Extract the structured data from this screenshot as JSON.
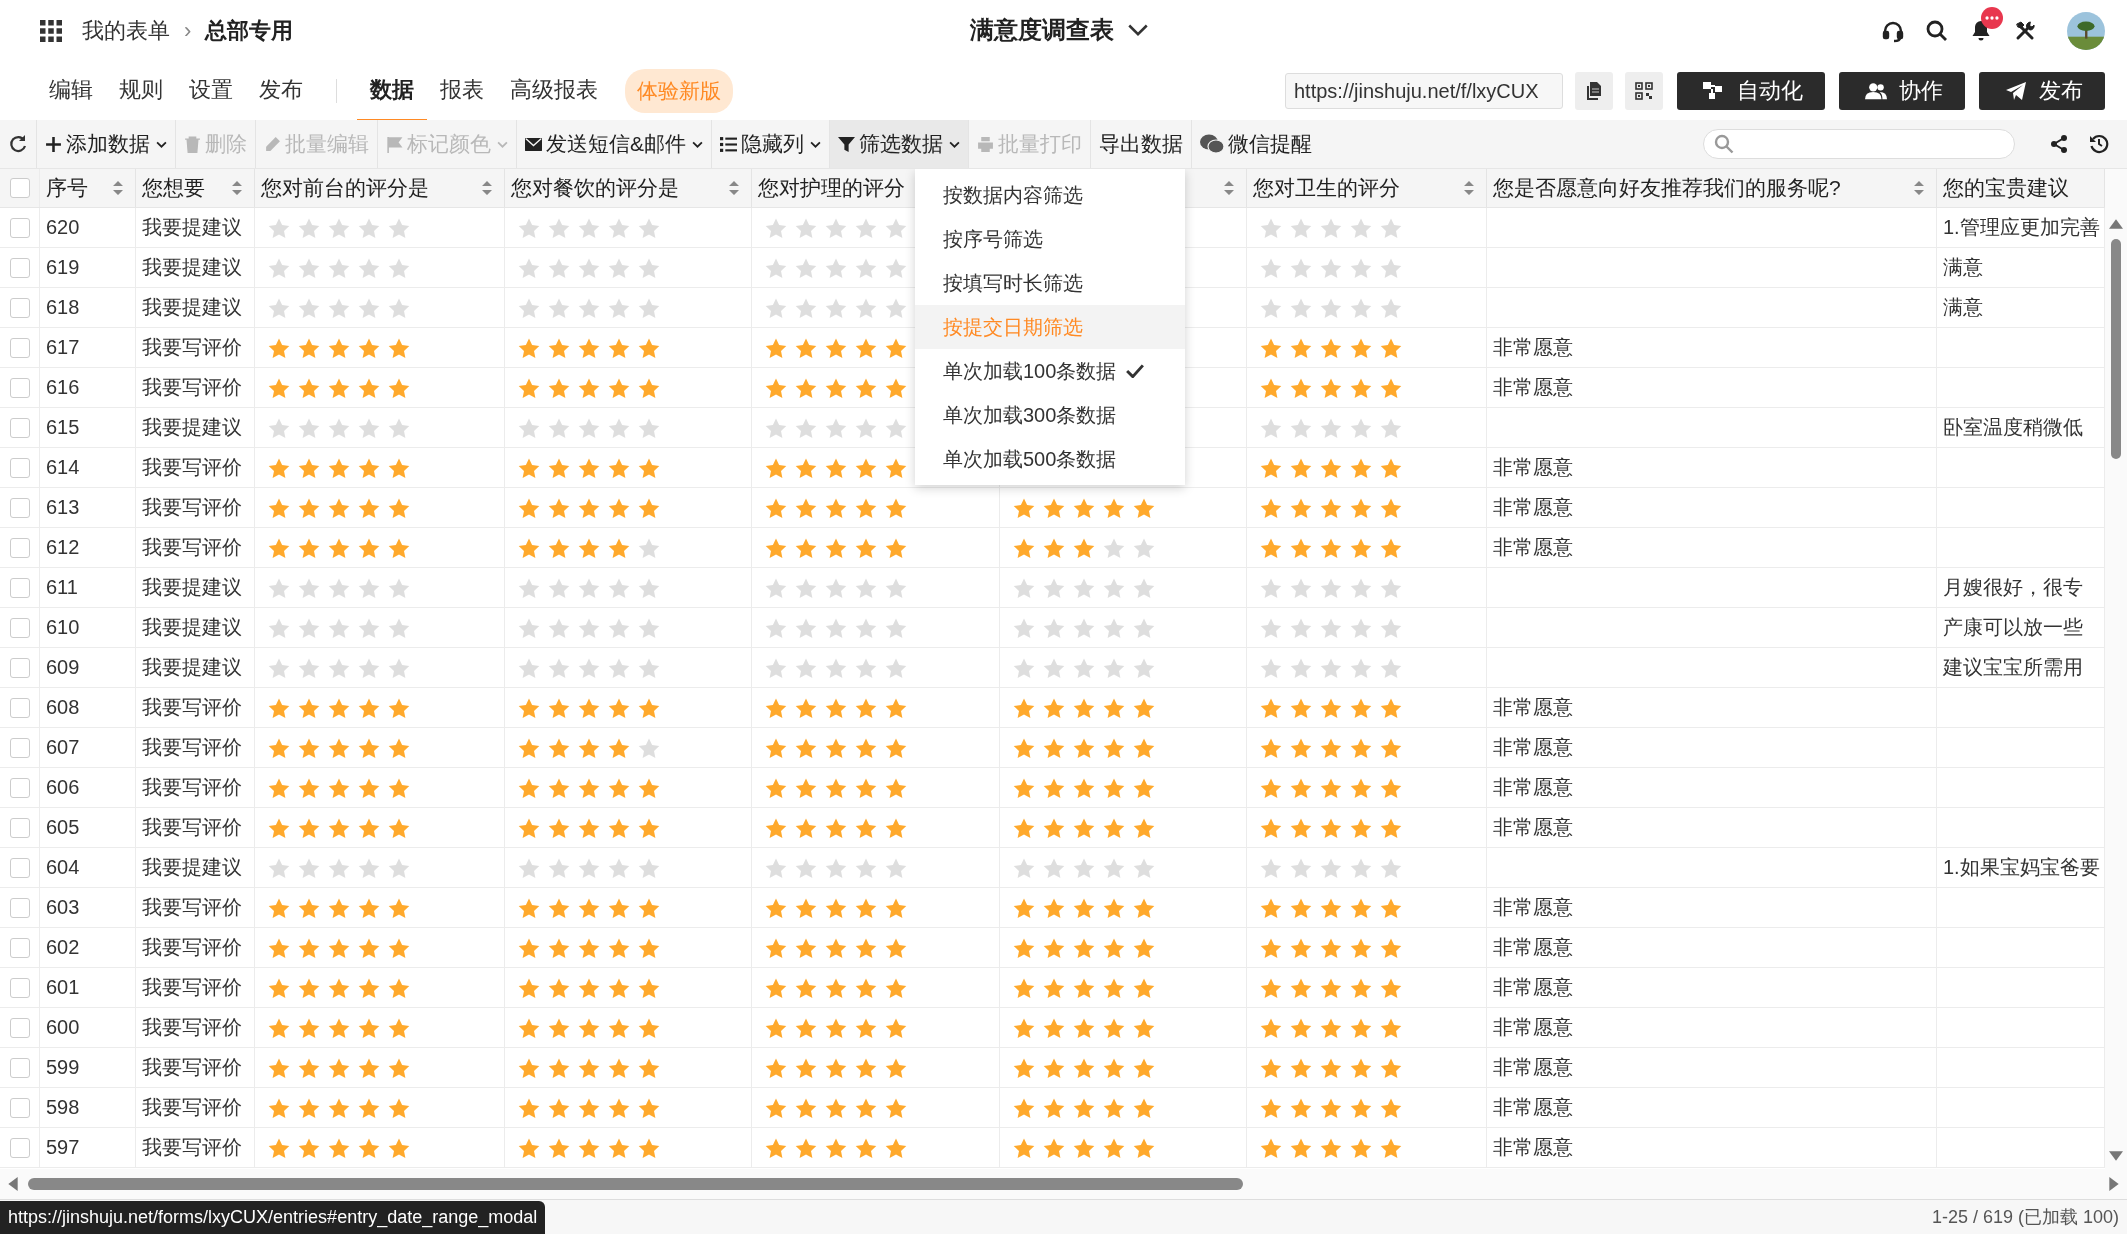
{
  "breadcrumb": {
    "root": "我的表单",
    "separator": "›",
    "current": "总部专用"
  },
  "title": "满意度调查表",
  "notifications": {
    "badge": true
  },
  "nav": {
    "left": [
      {
        "label": "编辑",
        "selected": false
      },
      {
        "label": "规则",
        "selected": false
      },
      {
        "label": "设置",
        "selected": false
      },
      {
        "label": "发布",
        "selected": false
      }
    ],
    "right": [
      {
        "label": "数据",
        "selected": true
      },
      {
        "label": "报表",
        "selected": false
      },
      {
        "label": "高级报表",
        "selected": false
      }
    ],
    "promo": "体验新版"
  },
  "share_url": "https://jinshuju.net/f/lxyCUX",
  "actions": [
    {
      "label": "自动化"
    },
    {
      "label": "协作"
    },
    {
      "label": "发布"
    }
  ],
  "toolbar": [
    {
      "label": "添加数据",
      "disabled": false,
      "caret": true,
      "active": false
    },
    {
      "label": "删除",
      "disabled": true,
      "caret": false,
      "active": false
    },
    {
      "label": "批量编辑",
      "disabled": true,
      "caret": false,
      "active": false
    },
    {
      "label": "标记颜色",
      "disabled": true,
      "caret": true,
      "active": false
    },
    {
      "label": "发送短信&邮件",
      "disabled": false,
      "caret": true,
      "active": false
    },
    {
      "label": "隐藏列",
      "disabled": false,
      "caret": true,
      "active": false
    },
    {
      "label": "筛选数据",
      "disabled": false,
      "caret": true,
      "active": true
    },
    {
      "label": "批量打印",
      "disabled": true,
      "caret": false,
      "active": false
    },
    {
      "label": "导出数据",
      "disabled": false,
      "caret": false,
      "active": false
    },
    {
      "label": "微信提醒",
      "disabled": false,
      "caret": false,
      "active": false
    }
  ],
  "table": {
    "select_all_checked": false,
    "columns": [
      {
        "label": "序号",
        "sortable": true
      },
      {
        "label": "您想要",
        "sortable": true
      },
      {
        "label": "您对前台的评分是",
        "sortable": true
      },
      {
        "label": "您对餐饮的评分是",
        "sortable": true
      },
      {
        "label": "您对护理的评分",
        "sortable": false
      },
      {
        "sortable": true
      },
      {
        "label": "您对卫生的评分",
        "sortable": true
      },
      {
        "label": "您是否愿意向好友推荐我们的服务呢?",
        "sortable": true
      },
      {
        "label": "您的宝贵建议",
        "sortable": false
      }
    ],
    "rows": [
      {
        "checked": false,
        "no": "620",
        "want": "我要提建议",
        "front": {
          "stars": 0
        },
        "dining": {
          "stars": 0
        },
        "nursing": {
          "stars": 0
        },
        "hygiene": {
          "stars": 0
        },
        "suggestion": "1.管理应更加完善"
      },
      {
        "checked": false,
        "no": "619",
        "want": "我要提建议",
        "front": {
          "stars": 0
        },
        "dining": {
          "stars": 0
        },
        "nursing": {
          "stars": 0
        },
        "hygiene": {
          "stars": 0
        },
        "suggestion": "满意"
      },
      {
        "checked": false,
        "no": "618",
        "want": "我要提建议",
        "front": {
          "stars": 0
        },
        "dining": {
          "stars": 0
        },
        "nursing": {
          "stars": 0
        },
        "hygiene": {
          "stars": 0
        },
        "suggestion": "满意"
      },
      {
        "checked": false,
        "no": "617",
        "want": "我要写评价",
        "front": {
          "stars": 5
        },
        "dining": {
          "stars": 5
        },
        "nursing": {
          "stars": 5
        },
        "hygiene": {
          "stars": 5
        },
        "recommend": "非常愿意"
      },
      {
        "checked": false,
        "no": "616",
        "want": "我要写评价",
        "front": {
          "stars": 5
        },
        "dining": {
          "stars": 5
        },
        "nursing": {
          "stars": 5
        },
        "hygiene": {
          "stars": 5
        },
        "recommend": "非常愿意"
      },
      {
        "checked": false,
        "no": "615",
        "want": "我要提建议",
        "front": {
          "stars": 0
        },
        "dining": {
          "stars": 0
        },
        "nursing": {
          "stars": 0
        },
        "hygiene": {
          "stars": 0
        },
        "suggestion": "卧室温度稍微低"
      },
      {
        "checked": false,
        "no": "614",
        "want": "我要写评价",
        "front": {
          "stars": 5
        },
        "dining": {
          "stars": 5
        },
        "nursing": {
          "stars": 5
        },
        "hygiene": {
          "stars": 5
        },
        "recommend": "非常愿意"
      },
      {
        "checked": false,
        "no": "613",
        "want": "我要写评价",
        "front": {
          "stars": 5
        },
        "dining": {
          "stars": 5
        },
        "nursing": {
          "stars": 5
        },
        "column_6": {
          "stars": 5
        },
        "hygiene": {
          "stars": 5
        },
        "recommend": "非常愿意"
      },
      {
        "checked": false,
        "no": "612",
        "want": "我要写评价",
        "front": {
          "stars": 5
        },
        "dining": {
          "stars": 4
        },
        "nursing": {
          "stars": 5
        },
        "column_6": {
          "stars": 3
        },
        "hygiene": {
          "stars": 5
        },
        "recommend": "非常愿意"
      },
      {
        "checked": false,
        "no": "611",
        "want": "我要提建议",
        "front": {
          "stars": 0
        },
        "dining": {
          "stars": 0
        },
        "nursing": {
          "stars": 0
        },
        "column_6": {
          "stars": 0
        },
        "hygiene": {
          "stars": 0
        },
        "suggestion": "月嫂很好，很专"
      },
      {
        "checked": false,
        "no": "610",
        "want": "我要提建议",
        "front": {
          "stars": 0
        },
        "dining": {
          "stars": 0
        },
        "nursing": {
          "stars": 0
        },
        "column_6": {
          "stars": 0
        },
        "hygiene": {
          "stars": 0
        },
        "suggestion": "产康可以放一些"
      },
      {
        "checked": false,
        "no": "609",
        "want": "我要提建议",
        "front": {
          "stars": 0
        },
        "dining": {
          "stars": 0
        },
        "nursing": {
          "stars": 0
        },
        "column_6": {
          "stars": 0
        },
        "hygiene": {
          "stars": 0
        },
        "suggestion": "建议宝宝所需用"
      },
      {
        "checked": false,
        "no": "608",
        "want": "我要写评价",
        "front": {
          "stars": 5
        },
        "dining": {
          "stars": 5
        },
        "nursing": {
          "stars": 5
        },
        "column_6": {
          "stars": 5
        },
        "hygiene": {
          "stars": 5
        },
        "recommend": "非常愿意"
      },
      {
        "checked": false,
        "no": "607",
        "want": "我要写评价",
        "front": {
          "stars": 5
        },
        "dining": {
          "stars": 4
        },
        "nursing": {
          "stars": 5
        },
        "column_6": {
          "stars": 5
        },
        "hygiene": {
          "stars": 5
        },
        "recommend": "非常愿意"
      },
      {
        "checked": false,
        "no": "606",
        "want": "我要写评价",
        "front": {
          "stars": 5
        },
        "dining": {
          "stars": 5
        },
        "nursing": {
          "stars": 5
        },
        "column_6": {
          "stars": 5
        },
        "hygiene": {
          "stars": 5
        },
        "recommend": "非常愿意"
      },
      {
        "checked": false,
        "no": "605",
        "want": "我要写评价",
        "front": {
          "stars": 5
        },
        "dining": {
          "stars": 5
        },
        "nursing": {
          "stars": 5
        },
        "column_6": {
          "stars": 5
        },
        "hygiene": {
          "stars": 5
        },
        "recommend": "非常愿意"
      },
      {
        "checked": false,
        "no": "604",
        "want": "我要提建议",
        "front": {
          "stars": 0
        },
        "dining": {
          "stars": 0
        },
        "nursing": {
          "stars": 0
        },
        "column_6": {
          "stars": 0
        },
        "hygiene": {
          "stars": 0
        },
        "suggestion": "1.如果宝妈宝爸要"
      },
      {
        "checked": false,
        "no": "603",
        "want": "我要写评价",
        "front": {
          "stars": 5
        },
        "dining": {
          "stars": 5
        },
        "nursing": {
          "stars": 5
        },
        "column_6": {
          "stars": 5
        },
        "hygiene": {
          "stars": 5
        },
        "recommend": "非常愿意"
      },
      {
        "checked": false,
        "no": "602",
        "want": "我要写评价",
        "front": {
          "stars": 5
        },
        "dining": {
          "stars": 5
        },
        "nursing": {
          "stars": 5
        },
        "column_6": {
          "stars": 5
        },
        "hygiene": {
          "stars": 5
        },
        "recommend": "非常愿意"
      },
      {
        "checked": false,
        "no": "601",
        "want": "我要写评价",
        "front": {
          "stars": 5
        },
        "dining": {
          "stars": 5
        },
        "nursing": {
          "stars": 5
        },
        "column_6": {
          "stars": 5
        },
        "hygiene": {
          "stars": 5
        },
        "recommend": "非常愿意"
      },
      {
        "checked": false,
        "no": "600",
        "want": "我要写评价",
        "front": {
          "stars": 5
        },
        "dining": {
          "stars": 5
        },
        "nursing": {
          "stars": 5
        },
        "column_6": {
          "stars": 5
        },
        "hygiene": {
          "stars": 5
        },
        "recommend": "非常愿意"
      },
      {
        "checked": false,
        "no": "599",
        "want": "我要写评价",
        "front": {
          "stars": 5
        },
        "dining": {
          "stars": 5
        },
        "nursing": {
          "stars": 5
        },
        "column_6": {
          "stars": 5
        },
        "hygiene": {
          "stars": 5
        },
        "recommend": "非常愿意"
      },
      {
        "checked": false,
        "no": "598",
        "want": "我要写评价",
        "front": {
          "stars": 5
        },
        "dining": {
          "stars": 5
        },
        "nursing": {
          "stars": 5
        },
        "column_6": {
          "stars": 5
        },
        "hygiene": {
          "stars": 5
        },
        "recommend": "非常愿意"
      },
      {
        "checked": false,
        "no": "597",
        "want": "我要写评价",
        "front": {
          "stars": 5
        },
        "dining": {
          "stars": 5
        },
        "nursing": {
          "stars": 5
        },
        "column_6": {
          "stars": 5
        },
        "hygiene": {
          "stars": 5
        },
        "recommend": "非常愿意"
      }
    ]
  },
  "filter_menu": [
    {
      "label": "按数据内容筛选",
      "highlighted": false,
      "checked": false
    },
    {
      "label": "按序号筛选",
      "highlighted": false,
      "checked": false
    },
    {
      "label": "按填写时长筛选",
      "highlighted": false,
      "checked": false
    },
    {
      "label": "按提交日期筛选",
      "highlighted": true,
      "checked": false
    },
    {
      "label": "单次加载100条数据",
      "highlighted": false,
      "checked": true
    },
    {
      "label": "单次加载300条数据",
      "highlighted": false,
      "checked": false
    },
    {
      "label": "单次加载500条数据",
      "highlighted": false,
      "checked": false
    }
  ],
  "link_preview": "https://jinshuju.net/forms/lxyCUX/entries#entry_date_range_modal",
  "status": "1-25 / 619 (已加载 100)"
}
